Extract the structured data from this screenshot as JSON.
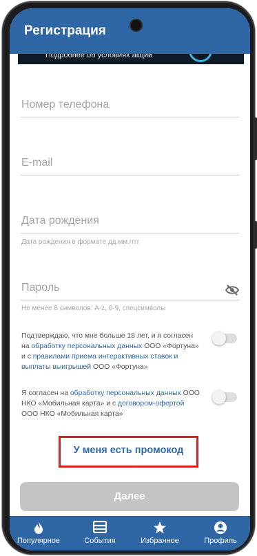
{
  "header": {
    "title": "Регистрация"
  },
  "promo_banner": {
    "text": "Подробнее об условиях акции"
  },
  "form": {
    "phone_placeholder": "Номер телефона",
    "email_placeholder": "E-mail",
    "birthdate_placeholder": "Дата рождения",
    "birthdate_hint": "Дата рождения в формате дд.мм.гггг",
    "password_placeholder": "Пароль",
    "password_hint": "Не менее 8 символов: A-z, 0-9, спецсимволы"
  },
  "consents": [
    {
      "text_1": "Подтверждаю, что мне больше 18 лет, и я согласен на ",
      "link_1": "обработку персональных данных",
      "text_2": " ООО «Фортуна» и с ",
      "link_2": "правилами приема интерактивных ставок и выплаты выигрышей",
      "text_3": " ООО «Фортуна»",
      "enabled": false
    },
    {
      "text_1": "Я согласен на ",
      "link_1": "обработку персональных данных",
      "text_2": " ООО НКО «Мобильная карта» и с ",
      "link_2": "договором-офертой",
      "text_3": " ООО НКО «Мобильная карта»",
      "enabled": false
    }
  ],
  "promo_link": "У меня есть промокод",
  "next_button": "Далее",
  "tabbar": [
    {
      "label": "Популярное",
      "icon": "flame-icon"
    },
    {
      "label": "События",
      "icon": "events-icon"
    },
    {
      "label": "Избранное",
      "icon": "star-icon"
    },
    {
      "label": "Профиль",
      "icon": "profile-icon"
    }
  ],
  "colors": {
    "primary": "#2e66a6",
    "link": "#2f68a8",
    "highlight_border": "#d81e1e",
    "button_disabled": "#c4c4c4"
  }
}
